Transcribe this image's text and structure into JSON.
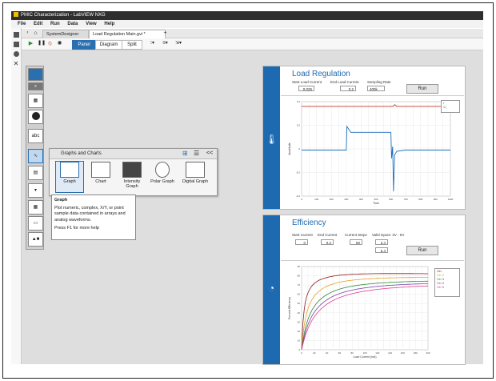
{
  "window": {
    "title": "PMIC Characterization - LabVIEW NXG"
  },
  "menu": [
    "File",
    "Edit",
    "Run",
    "Data",
    "View",
    "Help"
  ],
  "tabs": [
    {
      "label": "SystemDesigner"
    },
    {
      "label": "Load Regulation Main.gvi *"
    }
  ],
  "tab_add_label": "+",
  "toolbar": {
    "views": [
      "Panel",
      "Diagram",
      "Split"
    ],
    "active_view": "Panel"
  },
  "palette": {
    "items": [
      "data-icon",
      "search-icon",
      "numeric-icon",
      "boolean-icon",
      "string-icon",
      "graph-icon",
      "array-icon",
      "list-icon",
      "table-icon",
      "decoration-icon",
      "shapes-icon"
    ],
    "abc_label": "abc"
  },
  "flyout": {
    "title": "Graphs and Charts",
    "collapse_label": "<<",
    "items": [
      {
        "label": "Graph",
        "icon": "graph-icon"
      },
      {
        "label": "Chart",
        "icon": "chart-icon"
      },
      {
        "label": "Intensity Graph",
        "icon": "intensity-graph-icon"
      },
      {
        "label": "Polar Graph",
        "icon": "polar-graph-icon"
      },
      {
        "label": "Digital Graph",
        "icon": "digital-graph-icon"
      }
    ]
  },
  "tooltip": {
    "title": "Graph",
    "body": "Plot numeric, complex, X/Y, or point sample data contained in arrays and analog waveforms.",
    "footer": "Press F1 for more help"
  },
  "load_regulation": {
    "title": "Load Regulation",
    "fields": [
      {
        "label": "Start Load Current",
        "value": "0.025"
      },
      {
        "label": "End Load Current",
        "value": "0.2"
      },
      {
        "label": "Sampling Rate",
        "value": "400k"
      }
    ],
    "run_label": "Run",
    "legend": [
      "I",
      "V₀"
    ],
    "chart_data": {
      "type": "line",
      "xlabel": "Time",
      "ylabel": "Amplitude",
      "xlim": [
        0,
        1000
      ],
      "ylim": [
        -0.4,
        0.4
      ],
      "x_ticks": [
        "0",
        "50",
        "100",
        "150",
        "200",
        "250",
        "300",
        "350",
        "400",
        "450",
        "500",
        "550",
        "600",
        "650",
        "700",
        "750",
        "800",
        "850",
        "900",
        "950",
        "1000"
      ],
      "y_ticks": [
        "0.4",
        "0.2",
        "0",
        "-0.2",
        "-0.4"
      ],
      "series": [
        {
          "name": "I",
          "color": "#c0392b",
          "points": [
            [
              0,
              0.36
            ],
            [
              615,
              0.36
            ],
            [
              625,
              0.375
            ],
            [
              640,
              0.36
            ],
            [
              1000,
              0.36
            ]
          ]
        },
        {
          "name": "V₀",
          "color": "#1f6fc0",
          "points": [
            [
              0,
              -0.01
            ],
            [
              300,
              -0.01
            ],
            [
              305,
              0.19
            ],
            [
              320,
              0.16
            ],
            [
              330,
              0.14
            ],
            [
              600,
              0.14
            ],
            [
              605,
              -0.08
            ],
            [
              612,
              0.02
            ],
            [
              618,
              -0.36
            ],
            [
              625,
              -0.05
            ],
            [
              640,
              -0.02
            ],
            [
              700,
              -0.01
            ],
            [
              1000,
              -0.01
            ]
          ]
        }
      ]
    }
  },
  "efficiency": {
    "title": "Efficiency",
    "fields": [
      {
        "label": "Start Current",
        "value": "0"
      },
      {
        "label": "End Current",
        "value": "0.2"
      },
      {
        "label": "Current Steps",
        "value": "50"
      }
    ],
    "valid_inputs_label": "Valid inputs: 3V - 5V",
    "valid_inputs_values": [
      "3.4",
      "5.4"
    ],
    "run_label": "Run",
    "legend": [
      "Vin",
      "Vin 2",
      "Vin 3",
      "Vin 4",
      "Vin 5"
    ],
    "chart_data": {
      "type": "line",
      "xlabel": "Load Current (mA)",
      "ylabel": "Percent Efficiency",
      "xlim": [
        0,
        200
      ],
      "ylim": [
        0,
        90
      ],
      "x_ticks": [
        "0",
        "10",
        "20",
        "30",
        "40",
        "50",
        "60",
        "70",
        "80",
        "90",
        "100",
        "110",
        "120",
        "130",
        "140",
        "150",
        "160",
        "170",
        "180",
        "190",
        "200"
      ],
      "y_ticks": [
        "90",
        "80",
        "70",
        "60",
        "50",
        "40",
        "30",
        "20",
        "10",
        "0"
      ],
      "series": [
        {
          "name": "Vin",
          "color": "#8b1a1a",
          "k": 4,
          "ymax": 86
        },
        {
          "name": "Vin 2",
          "color": "#e6a020",
          "k": 9,
          "ymax": 84
        },
        {
          "name": "Vin 3",
          "color": "#2e8b2e",
          "k": 15,
          "ymax": 82
        },
        {
          "name": "Vin 4",
          "color": "#7a3fb0",
          "k": 20,
          "ymax": 81
        },
        {
          "name": "Vin 5",
          "color": "#e0408a",
          "k": 25,
          "ymax": 80
        }
      ]
    }
  }
}
